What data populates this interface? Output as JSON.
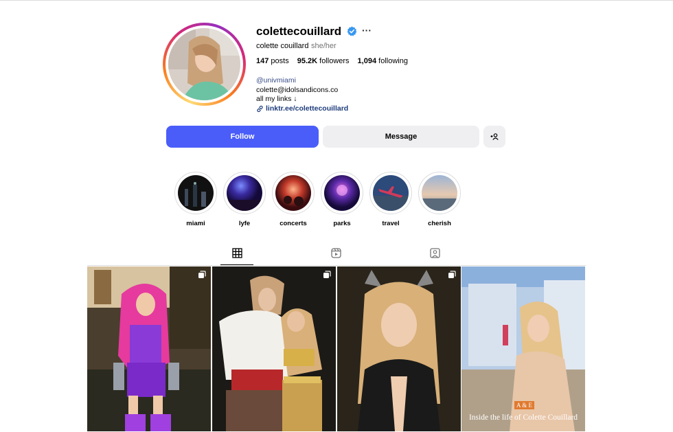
{
  "profile": {
    "username": "colettecouillard",
    "full_name": "colette couillard",
    "pronouns": "she/her",
    "more_label": "···",
    "verified": true
  },
  "stats": {
    "posts_count": "147",
    "posts_label": "posts",
    "followers_count": "95.2K",
    "followers_label": "followers",
    "following_count": "1,094",
    "following_label": "following"
  },
  "bio": {
    "mention": "@univmiami",
    "email": "colette@idolsandicons.co",
    "line3": "all my links ↓",
    "link": "linktr.ee/colettecouillard"
  },
  "actions": {
    "follow_label": "Follow",
    "message_label": "Message",
    "suggest_label": "+👤"
  },
  "highlights": [
    {
      "label": "miami"
    },
    {
      "label": "lyfe"
    },
    {
      "label": "concerts"
    },
    {
      "label": "parks"
    },
    {
      "label": "travel"
    },
    {
      "label": "cherish"
    }
  ],
  "tabs": [
    {
      "icon": "grid-icon",
      "active": true
    },
    {
      "icon": "reels-icon",
      "active": false
    },
    {
      "icon": "tagged-icon",
      "active": false
    }
  ],
  "posts": [
    {
      "icon": "carousel-icon"
    },
    {
      "icon": "carousel-icon"
    },
    {
      "icon": "carousel-icon"
    },
    {
      "badge": "A & E",
      "caption": "Inside the life of Colette Couillard"
    }
  ],
  "colors": {
    "accent": "#4a5df9",
    "verified": "#3897f0",
    "secondary_button": "#efeff2"
  }
}
